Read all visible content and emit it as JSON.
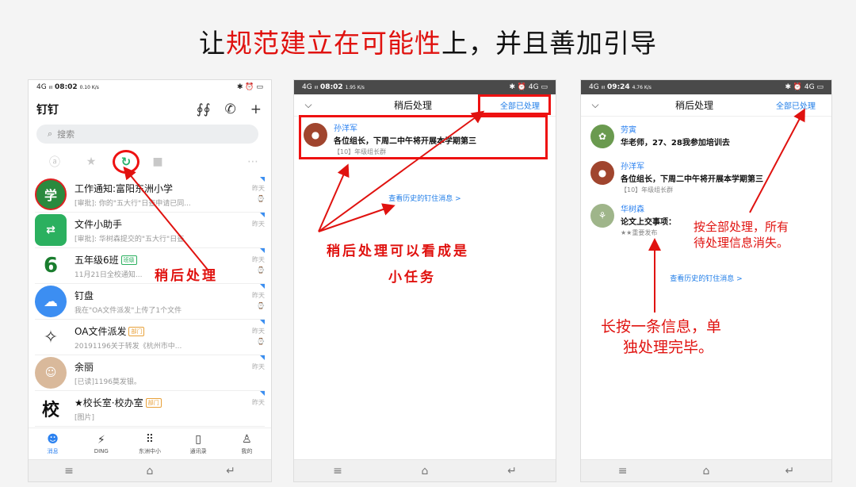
{
  "slide": {
    "title_pre": "让",
    "title_red": "规范建立在可能性",
    "title_post": "上，并且善加引导"
  },
  "phone1": {
    "status": {
      "signal": "4G ᵢₗₗ",
      "time": "08:02",
      "speed": "0.10 K/s",
      "icons": "✱ ⏰ ▭"
    },
    "title": "钉钉",
    "search_placeholder": "搜索",
    "chats": [
      {
        "name": "工作通知:富阳东洲小学",
        "preview": "[审批]: 你的\"五大行\"日查申请已同...",
        "time": "昨天",
        "avatar_text": "学",
        "avatar_color": "#2a8a3e"
      },
      {
        "name": "文件小助手",
        "preview": "[审批]: 华树森提交的\"五大行\"日查",
        "time": "昨天",
        "avatar_text": "▭",
        "avatar_color": "#2bb05f"
      },
      {
        "name": "五年级6班",
        "tag": "班级",
        "preview": "11月21日全校通知...",
        "time": "昨天",
        "avatar_text": "6",
        "avatar_color": "#ffffff"
      },
      {
        "name": "钉盘",
        "preview": "我在\"OA文件派发\"上传了1个文件",
        "time": "昨天",
        "avatar_text": "☁",
        "avatar_color": "#3c8ef2"
      },
      {
        "name": "OA文件派发",
        "tag": "部门",
        "preview": "20191196关于转发《杭州市中...",
        "time": "昨天",
        "avatar_text": "✧",
        "avatar_color": "#ffffff"
      },
      {
        "name": "余丽",
        "preview": "[已读]1196莫发银。",
        "time": "昨天",
        "avatar_text": "余",
        "avatar_color": "#d9b99b"
      },
      {
        "name": "★校长室·校办室",
        "tag": "部门",
        "preview": "[图片]",
        "time": "昨天",
        "avatar_text": "校",
        "avatar_color": "#ffffff"
      }
    ],
    "nav": [
      {
        "label": "消息",
        "icon": "☻"
      },
      {
        "label": "DING",
        "icon": "⚡"
      },
      {
        "label": "东洲中小",
        "icon": "⠿"
      },
      {
        "label": "通讯录",
        "icon": "▯"
      },
      {
        "label": "我的",
        "icon": "♙"
      }
    ],
    "annotation": "稍后处理"
  },
  "phone2": {
    "status": {
      "signal": "4G ᵢₗₗ",
      "time": "08:02",
      "speed": "1.95 K/s",
      "icons": "✱ ⏰ 4G ▭"
    },
    "title": "稍后处理",
    "action": "全部已处理",
    "message": {
      "name": "孙洋军",
      "text": "各位组长，下周二中午将开展本学期第三",
      "sub": "【10】年级组长群"
    },
    "history_link": "查看历史的钉住消息 >",
    "annotation_line1": "稍后处理可以看成是",
    "annotation_line2": "小任务"
  },
  "phone3": {
    "status": {
      "signal": "4G ᵢₗₗ",
      "time": "09:24",
      "speed": "4.76 K/s",
      "icons": "✱ ⏰ 4G ▭"
    },
    "title": "稍后处理",
    "action": "全部已处理",
    "messages": [
      {
        "name": "劳寅",
        "text": "华老师，27、28我参加培训去",
        "sub": "",
        "avatar_color": "#6a9a4f"
      },
      {
        "name": "孙洋军",
        "text": "各位组长，下周二中午将开展本学期第三",
        "sub": "【10】年级组长群",
        "avatar_color": "#a0452e"
      },
      {
        "name": "华树森",
        "text": "论文上交事项：",
        "sub": "★★重要发布",
        "avatar_color": "#9fb58a"
      }
    ],
    "history_link": "查看历史的钉住消息 >",
    "annotation_top_line1": "按全部处理，所有",
    "annotation_top_line2": "待处理信息消失。",
    "annotation_bottom_line1": "长按一条信息，单",
    "annotation_bottom_line2": "独处理完毕。"
  }
}
